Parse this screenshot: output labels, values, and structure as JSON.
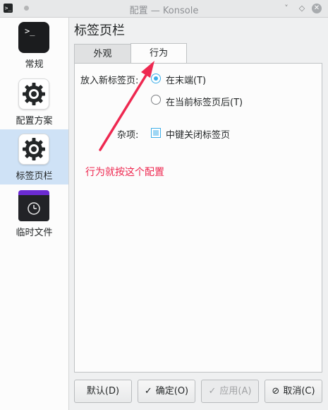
{
  "window": {
    "title": "配置 — Konsole",
    "app_icon": ">_",
    "controls": {
      "minimize": "˅",
      "maximize": "◇",
      "close": "✕"
    }
  },
  "sidebar": {
    "items": [
      {
        "label": "常规",
        "icon": "terminal-icon",
        "icon_text": ">_",
        "selected": false
      },
      {
        "label": "配置方案",
        "icon": "gear-icon",
        "selected": false
      },
      {
        "label": "标签页栏",
        "icon": "gear-icon",
        "selected": true
      },
      {
        "label": "临时文件",
        "icon": "folder-clock-icon",
        "selected": false
      }
    ]
  },
  "page": {
    "title": "标签页栏"
  },
  "tabs": [
    {
      "label": "外观",
      "active": false
    },
    {
      "label": "行为",
      "active": true
    }
  ],
  "behavior": {
    "new_tab_label": "放入新标签页:",
    "options": [
      {
        "label": "在末端(T)",
        "checked": true
      },
      {
        "label": "在当前标签页后(T)",
        "checked": false
      }
    ],
    "misc_label": "杂项:",
    "middle_click_close": {
      "label": "中键关闭标签页",
      "checked": true
    }
  },
  "annotation": {
    "text": "行为就按这个配置",
    "color": "#ee2850"
  },
  "buttons": {
    "defaults": "默认(D)",
    "ok": "确定(O)",
    "apply": "应用(A)",
    "cancel": "取消(C)"
  },
  "colors": {
    "accent": "#3daee9",
    "selection": "#cfe2f6",
    "annotation": "#ee2850"
  }
}
